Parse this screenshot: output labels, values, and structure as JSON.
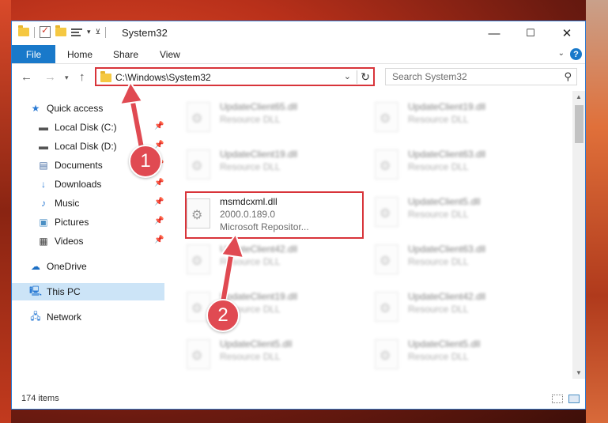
{
  "window": {
    "title": "System32",
    "controls": {
      "minimize": "—",
      "maximize": "☐",
      "close": "✕"
    }
  },
  "ribbon": {
    "file_tab": "File",
    "tabs": [
      "Home",
      "Share",
      "View"
    ],
    "help": "?"
  },
  "navigation": {
    "address": "C:\\Windows\\System32",
    "search_placeholder": "Search System32"
  },
  "sidebar": {
    "quick_access": "Quick access",
    "items": [
      {
        "label": "Local Disk (C:)",
        "icon": "drive-icon",
        "pinned": true
      },
      {
        "label": "Local Disk (D:)",
        "icon": "drive-icon",
        "pinned": true
      },
      {
        "label": "Documents",
        "icon": "documents-icon",
        "pinned": true
      },
      {
        "label": "Downloads",
        "icon": "downloads-icon",
        "pinned": true
      },
      {
        "label": "Music",
        "icon": "music-icon",
        "pinned": true
      },
      {
        "label": "Pictures",
        "icon": "pictures-icon",
        "pinned": true
      },
      {
        "label": "Videos",
        "icon": "videos-icon",
        "pinned": true
      }
    ],
    "onedrive": "OneDrive",
    "this_pc": "This PC",
    "network": "Network"
  },
  "files": {
    "col1": [
      {
        "name": "UpdateClient65.dll",
        "type": "Resource DLL"
      },
      {
        "name": "UpdateClient19.dll",
        "type": "Resource DLL"
      },
      {
        "name": "msmdcxml.dll",
        "version": "2000.0.189.0",
        "company": "Microsoft Repositor..."
      },
      {
        "name": "UpdateClient42.dll",
        "type": "Resource DLL"
      },
      {
        "name": "UpdateClient19.dll",
        "type": "Resource DLL"
      },
      {
        "name": "UpdateClient5.dll",
        "type": "Resource DLL"
      }
    ],
    "col2": [
      {
        "name": "UpdateClient19.dll",
        "type": "Resource DLL"
      },
      {
        "name": "UpdateClient63.dll",
        "type": "Resource DLL"
      },
      {
        "name": "UpdateClient5.dll",
        "type": "Resource DLL"
      },
      {
        "name": "UpdateClient63.dll",
        "type": "Resource DLL"
      },
      {
        "name": "UpdateClient42.dll",
        "type": "Resource DLL"
      },
      {
        "name": "UpdateClient5.dll",
        "type": "Resource DLL"
      }
    ]
  },
  "status": {
    "item_count": "174 items"
  },
  "annotations": {
    "step1": "1",
    "step2": "2",
    "color": "#e04a52"
  }
}
